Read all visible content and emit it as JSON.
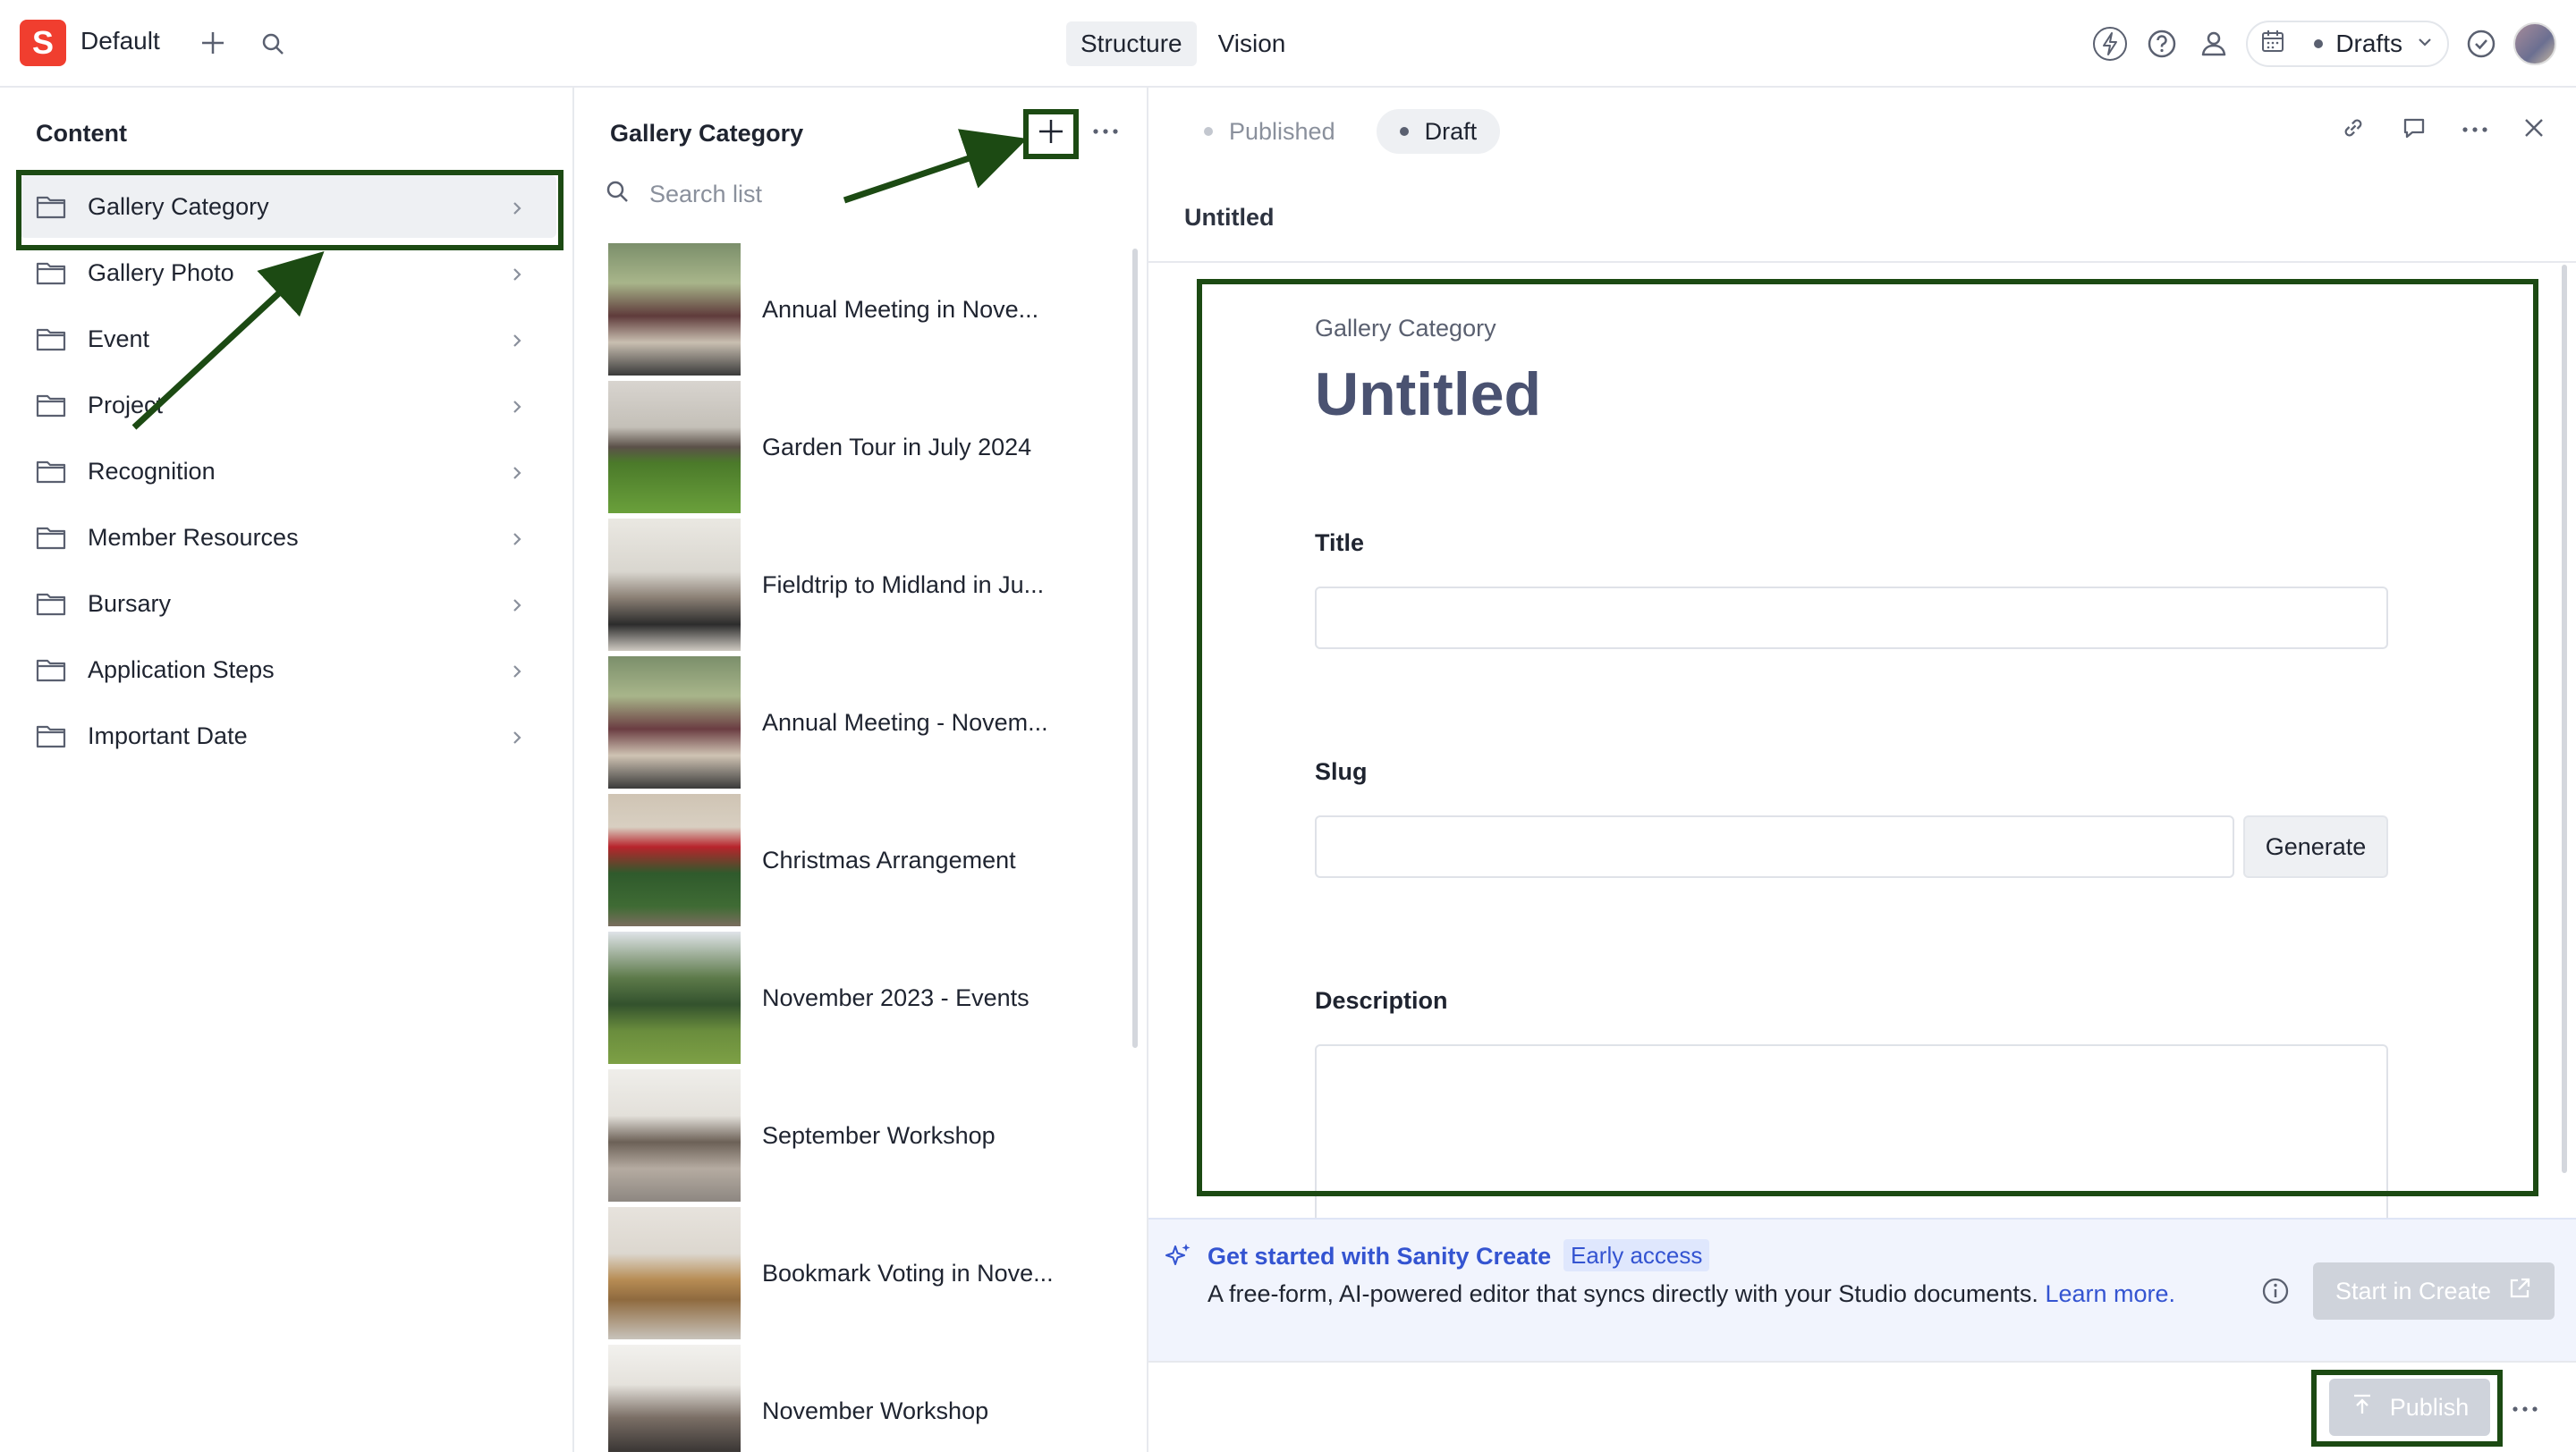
{
  "topbar": {
    "logo_letter": "S",
    "workspace": "Default",
    "tabs": [
      "Structure",
      "Vision"
    ],
    "active_tab": "Structure",
    "drafts_label": "Drafts"
  },
  "content_pane": {
    "title": "Content",
    "items": [
      {
        "label": "Gallery Category",
        "selected": true
      },
      {
        "label": "Gallery Photo"
      },
      {
        "label": "Event"
      },
      {
        "label": "Project"
      },
      {
        "label": "Recognition"
      },
      {
        "label": "Member Resources"
      },
      {
        "label": "Bursary"
      },
      {
        "label": "Application Steps"
      },
      {
        "label": "Important Date"
      }
    ]
  },
  "list_pane": {
    "title": "Gallery Category",
    "search_placeholder": "Search list",
    "items": [
      {
        "label": "Annual Meeting in Nove..."
      },
      {
        "label": "Garden Tour in July 2024"
      },
      {
        "label": "Fieldtrip to Midland in Ju..."
      },
      {
        "label": "Annual Meeting - Novem..."
      },
      {
        "label": "Christmas Arrangement"
      },
      {
        "label": "November 2023 - Events"
      },
      {
        "label": "September Workshop"
      },
      {
        "label": "Bookmark Voting in Nove..."
      },
      {
        "label": "November Workshop"
      }
    ]
  },
  "document": {
    "status_tabs": [
      "Published",
      "Draft"
    ],
    "active_status": "Draft",
    "header_title": "Untitled",
    "type_label": "Gallery Category",
    "title": "Untitled",
    "fields": {
      "title_label": "Title",
      "title_value": "",
      "slug_label": "Slug",
      "slug_value": "",
      "generate_label": "Generate",
      "description_label": "Description",
      "description_value": ""
    }
  },
  "create_banner": {
    "title": "Get started with Sanity Create",
    "badge": "Early access",
    "text": "A free-form, AI-powered editor that syncs directly with your Studio documents.",
    "link": "Learn more.",
    "button": "Start in Create"
  },
  "footer": {
    "publish_label": "Publish"
  },
  "colors": {
    "brand": "#f03e2f",
    "annotation": "#1c4a13",
    "link": "#3454d1"
  }
}
